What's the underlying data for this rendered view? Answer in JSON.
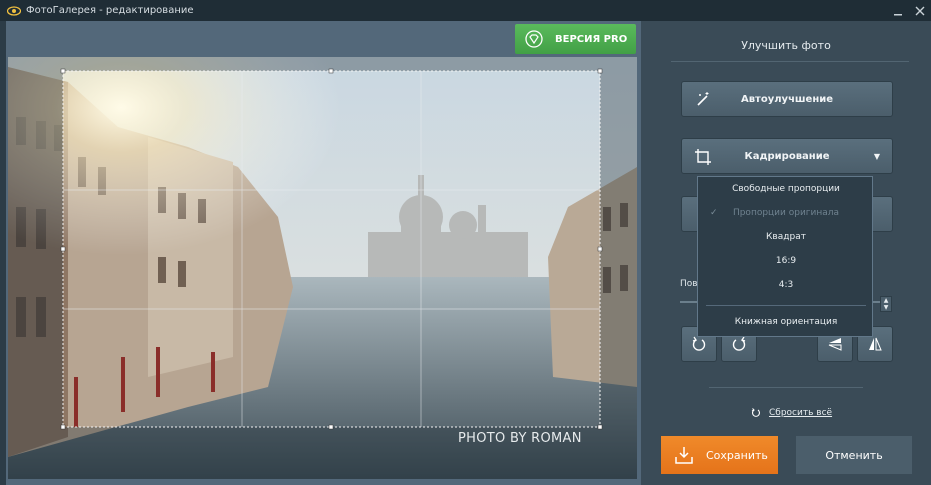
{
  "window": {
    "title": "ФотоГалерея - редактирование"
  },
  "pro_button": {
    "label": "ВЕРСИЯ PRO"
  },
  "photo": {
    "watermark": "PHOTO BY ROMAN"
  },
  "panel": {
    "title": "Улучшить фото",
    "auto_enhance_label": "Автоулучшение",
    "crop_label": "Кадрирование",
    "rotate_label_partial": "Пово"
  },
  "crop_menu": {
    "items": [
      {
        "label": "Свободные пропорции",
        "checked": false,
        "disabled": false
      },
      {
        "label": "Пропорции оригинала",
        "checked": true,
        "disabled": true
      },
      {
        "label": "Квадрат",
        "checked": false,
        "disabled": false
      },
      {
        "label": "16:9",
        "checked": false,
        "disabled": false
      },
      {
        "label": "4:3",
        "checked": false,
        "disabled": false
      },
      {
        "label": "Книжная ориентация",
        "checked": false,
        "disabled": false
      }
    ]
  },
  "reset_label": "Сбросить всё",
  "save_label": "Сохранить",
  "cancel_label": "Отменить",
  "colors": {
    "accent_orange": "#E5731A",
    "pro_green": "#42A046",
    "panel_bg": "#3A4B57"
  }
}
